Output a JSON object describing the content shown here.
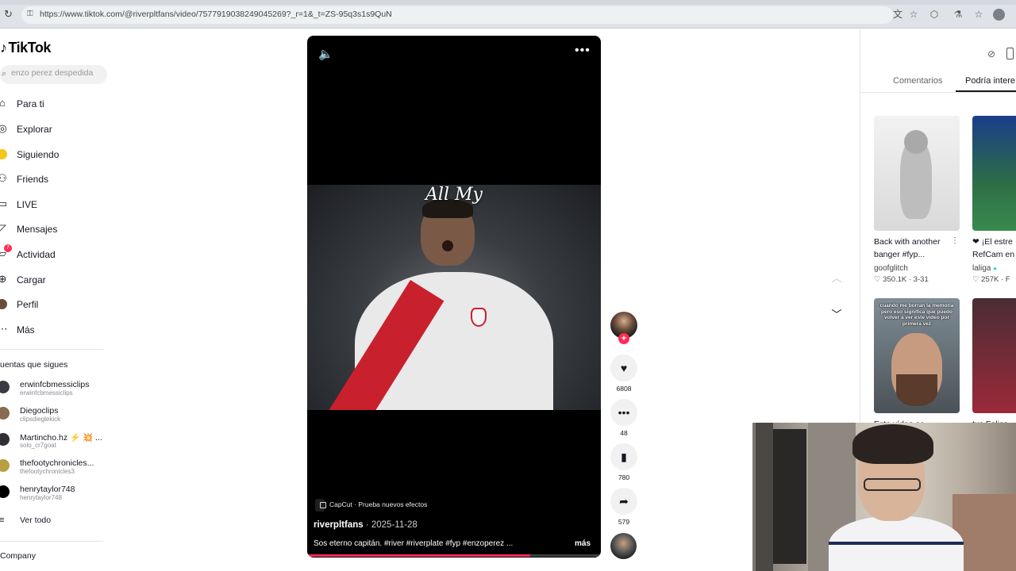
{
  "browser": {
    "url": "https://www.tiktok.com/@riverpltfans/video/7577919038249045269?_r=1&_t=ZS-95q3s1s9QuN",
    "icons": [
      "reload-icon",
      "lock-icon",
      "translate-icon",
      "star-icon",
      "extensions-icon",
      "flask-icon",
      "bookmarks-icon",
      "profile-avatar"
    ]
  },
  "sidebar": {
    "logo": "TikTok",
    "search_placeholder": "enzo perez despedida",
    "nav": [
      {
        "label": "Para ti",
        "icon": "home-icon"
      },
      {
        "label": "Explorar",
        "icon": "compass-icon"
      },
      {
        "label": "Siguiendo",
        "icon": "following-icon"
      },
      {
        "label": "Friends",
        "icon": "friends-icon"
      },
      {
        "label": "LIVE",
        "icon": "live-icon"
      },
      {
        "label": "Mensajes",
        "icon": "messages-icon"
      },
      {
        "label": "Actividad",
        "icon": "activity-icon",
        "badge": "7"
      },
      {
        "label": "Cargar",
        "icon": "upload-icon"
      },
      {
        "label": "Perfil",
        "icon": "profile-icon"
      },
      {
        "label": "Más",
        "icon": "more-icon"
      }
    ],
    "following_title": "uentas que sigues",
    "accounts": [
      {
        "name": "erwinfcbmessiclips",
        "handle": "erwinfcbmessiclips"
      },
      {
        "name": "Diegoclips",
        "handle": "clipsdieglekick"
      },
      {
        "name": "Martincho.hz ⚡ 💥 ...",
        "handle": "solo_cr7goat"
      },
      {
        "name": "thefootychronicles...",
        "handle": "thefootychronicles3"
      },
      {
        "name": "henrytaylor748",
        "handle": "henrytaylor748"
      }
    ],
    "see_all": "Ver todo",
    "company": "Company"
  },
  "video": {
    "overlay_text": "All My",
    "effect_badge": "CapCut · Prueba nuevos efectos",
    "author": "riverpltfans",
    "date": " · 2025-11-28",
    "caption": "Sos eterno capitán. #river #riverplate #fyp #enzoperez ...",
    "more_label": "más",
    "progress_fraction": 0.76
  },
  "actions": {
    "likes": "6808",
    "comments": "48",
    "saves": "780",
    "shares": "579"
  },
  "right_panel": {
    "tab_comments": "Comentarios",
    "tab_related": "Podría intere",
    "cards": [
      {
        "title_line1": "Back with another",
        "title_line2": "banger #fyp...",
        "author": "goofglitch",
        "stats": "♡ 350.1K · 3-31"
      },
      {
        "title_line1": "❤ ¡El estre",
        "title_line2": "RefCam en",
        "author": "laliga",
        "stats": "♡ 257K · F"
      },
      {
        "overlay": "cuando me borran la memoria pero eso significa que puedo volver a ver este video por primera vez",
        "title_line1": "Este vídeo es",
        "author": ""
      },
      {
        "title_line1": "tus Felice",
        "author": ""
      }
    ]
  },
  "colors": {
    "accent": "#fe2c55",
    "text": "#161823",
    "muted": "#8a8b91"
  }
}
